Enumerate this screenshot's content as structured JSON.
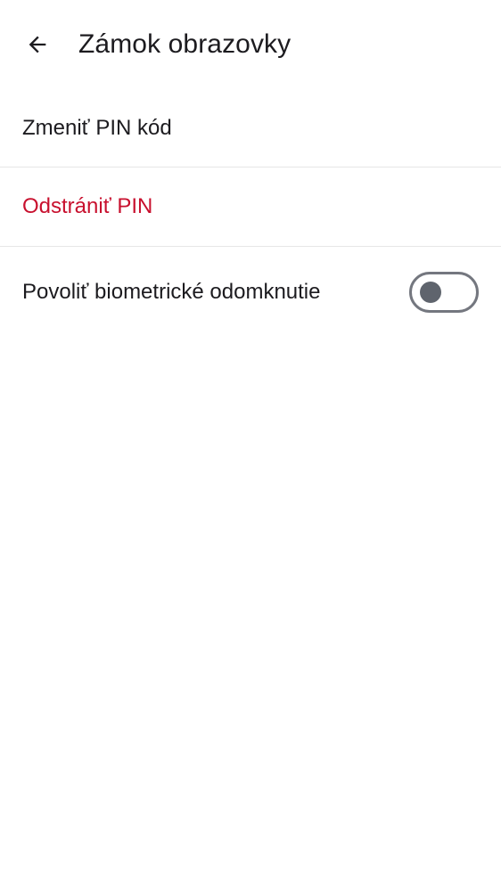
{
  "app_bar": {
    "title": "Zámok obrazovky",
    "back_icon": "arrow-back-icon"
  },
  "settings": {
    "change_pin_label": "Zmeniť PIN kód",
    "remove_pin_label": "Odstrániť PIN",
    "biometric_label": "Povoliť biometrické odomknutie",
    "biometric_enabled": false
  },
  "colors": {
    "danger": "#c8102e",
    "text": "#1c1b1f",
    "divider": "#e6e6e6",
    "toggle_outline": "#74777f",
    "toggle_knob": "#5f646d"
  }
}
